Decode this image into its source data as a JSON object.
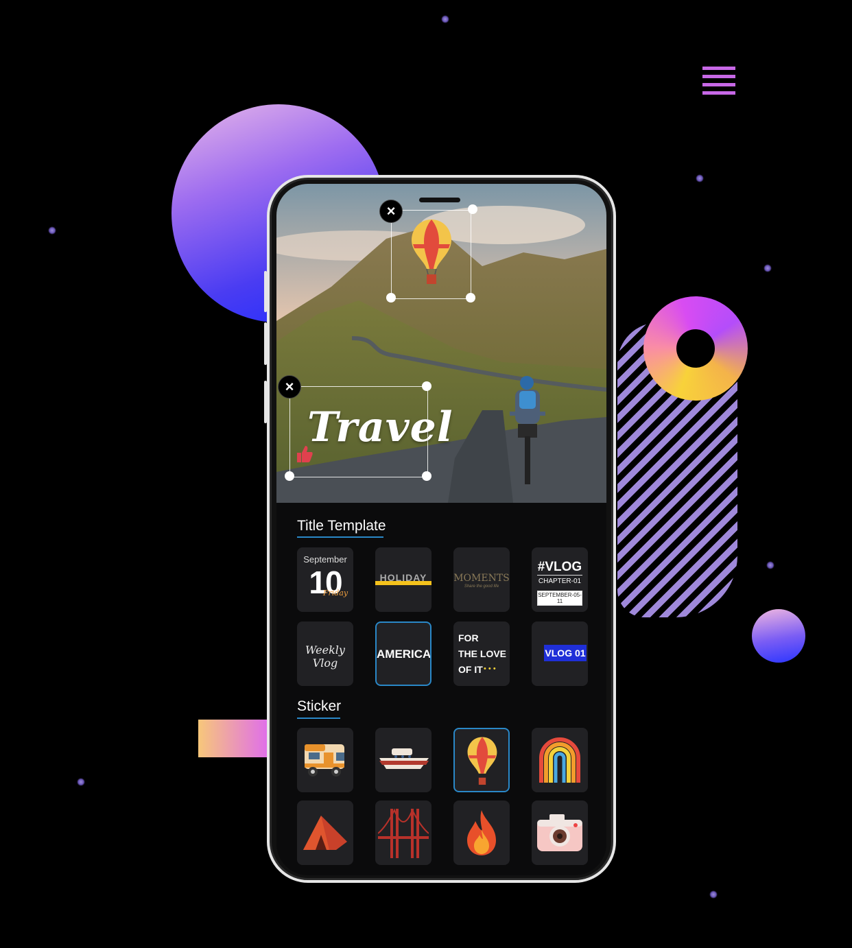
{
  "canvas": {
    "title_text": "Travel"
  },
  "panel": {
    "title_template_label": "Title Template",
    "sticker_label": "Sticker",
    "templates": [
      {
        "name": "september-10",
        "line1": "September",
        "line2": "10",
        "line3": "Friday"
      },
      {
        "name": "holiday",
        "line1": "HOLIDAY"
      },
      {
        "name": "moments",
        "line1": "MOMENTS",
        "line2": "Share the good life"
      },
      {
        "name": "vlog-chapter",
        "line1": "#VLOG",
        "line2": "CHAPTER-01",
        "line3": "SEPTEMBER-05-11"
      },
      {
        "name": "weekly-vlog",
        "line1": "Weekly Vlog"
      },
      {
        "name": "america",
        "line1": "AMERICA"
      },
      {
        "name": "for-the-love",
        "line1": "FOR",
        "line2": "THE LOVE",
        "line3": "OF IT",
        "line4": "• • •"
      },
      {
        "name": "vlog-01",
        "line1": "VLOG 01"
      }
    ],
    "stickers": [
      {
        "name": "camper-van-icon"
      },
      {
        "name": "boat-icon"
      },
      {
        "name": "hot-air-balloon-icon"
      },
      {
        "name": "rainbow-icon"
      },
      {
        "name": "tent-icon"
      },
      {
        "name": "golden-gate-bridge-icon"
      },
      {
        "name": "fire-icon"
      },
      {
        "name": "camera-icon"
      }
    ],
    "selected_template_index": 5,
    "selected_sticker_index": 2
  },
  "colors": {
    "accent": "#2a88c8",
    "tile_bg": "#212124",
    "panel_bg": "#0b0b0c"
  }
}
